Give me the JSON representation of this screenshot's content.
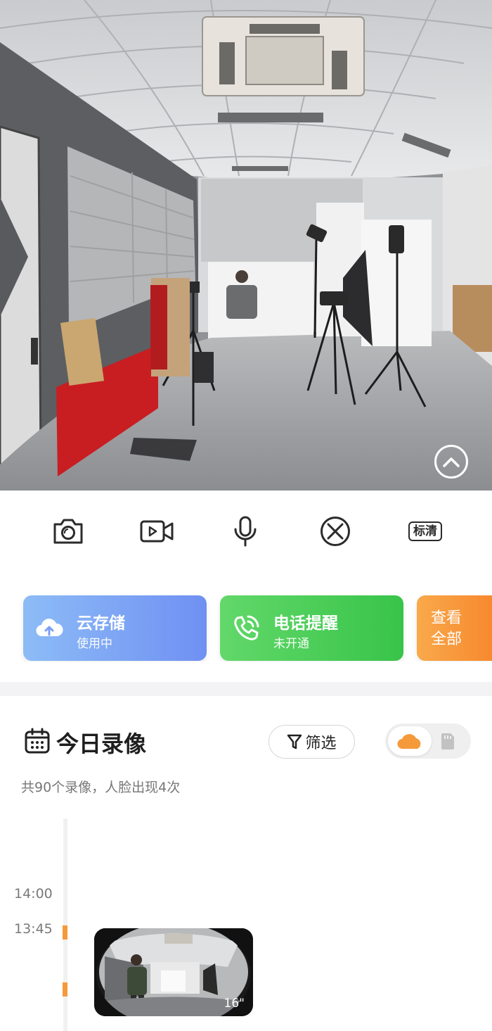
{
  "live_view": {
    "collapse_icon": "chevron-up-icon"
  },
  "toolbar": {
    "screenshot_icon": "camera-icon",
    "record_icon": "video-icon",
    "talk_icon": "microphone-icon",
    "close_icon": "close-circle-icon",
    "quality_label": "标清"
  },
  "cards": {
    "cloud": {
      "title": "云存储",
      "subtitle": "使用中",
      "icon": "cloud-upload-icon"
    },
    "phone": {
      "title": "电话提醒",
      "subtitle": "未开通",
      "icon": "phone-ring-icon"
    },
    "all": {
      "line1": "查看",
      "line2": "全部"
    }
  },
  "recordings": {
    "title": "今日录像",
    "filter_label": "筛选",
    "summary": "共90个录像，人脸出现4次",
    "storage_options": [
      "cloud-icon",
      "sd-card-icon"
    ],
    "times": [
      "14:00",
      "13:45"
    ],
    "clips": [
      {
        "duration": "16\""
      }
    ]
  },
  "colors": {
    "accent_orange": "#f59a3b",
    "cloud_card": "#7a9ff4",
    "phone_card": "#45c952",
    "all_card": "#f8922f"
  }
}
